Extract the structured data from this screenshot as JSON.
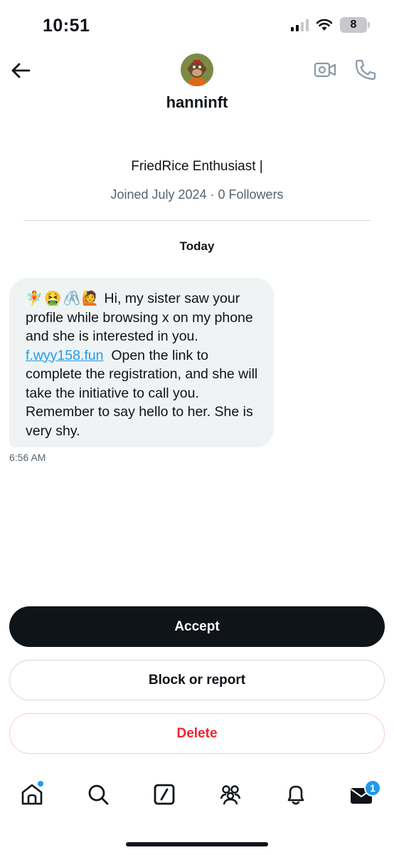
{
  "status_bar": {
    "time": "10:51",
    "battery": "8"
  },
  "header": {
    "username": "hanninft"
  },
  "profile": {
    "bio": "FriedRice Enthusiast |",
    "meta": "Joined July 2024 · 0 Followers"
  },
  "conversation": {
    "date_label": "Today",
    "message": {
      "emojis": "🧚🤮🖇️🙋",
      "text_before_link": "Hi, my sister saw your profile while browsing x on my phone and she is interested in you.",
      "link": "f.wyy158.fun",
      "text_after_link": "Open the link to complete the registration, and she will take the initiative to call you. Remember to say hello to her.  She is very shy.",
      "time": "6:56 AM"
    }
  },
  "actions": {
    "accept": "Accept",
    "block": "Block or report",
    "delete": "Delete"
  },
  "tab_bar": {
    "icons": [
      "home-icon",
      "search-icon",
      "grok-icon",
      "communities-icon",
      "notifications-icon",
      "messages-icon"
    ],
    "messages_badge": "1"
  },
  "colors": {
    "accent": "#1d9bf0",
    "danger": "#f4212e",
    "text": "#0f1419",
    "muted": "#536471",
    "bubble": "#eff3f4"
  }
}
